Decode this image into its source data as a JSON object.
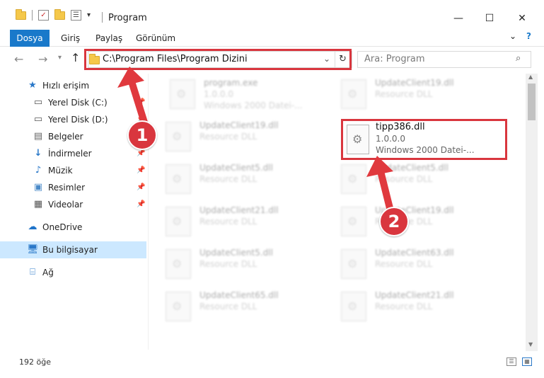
{
  "window": {
    "title": "Program",
    "minimize": "—",
    "maximize": "☐",
    "close": "✕"
  },
  "ribbon": {
    "tabs": [
      "Dosya",
      "Giriş",
      "Paylaş",
      "Görünüm"
    ],
    "expand": "⌄",
    "help": "?"
  },
  "address": {
    "path": "C:\\Program Files\\Program Dizini",
    "search_placeholder": "Ara: Program"
  },
  "sidebar": {
    "items": [
      {
        "label": "Hızlı erişim",
        "icon": "star-icon"
      },
      {
        "label": "Yerel Disk (C:)",
        "icon": "drive-icon"
      },
      {
        "label": "Yerel Disk (D:)",
        "icon": "drive-icon"
      },
      {
        "label": "Belgeler",
        "icon": "documents-icon"
      },
      {
        "label": "İndirmeler",
        "icon": "download-icon"
      },
      {
        "label": "Müzik",
        "icon": "music-icon"
      },
      {
        "label": "Resimler",
        "icon": "pictures-icon"
      },
      {
        "label": "Videolar",
        "icon": "video-icon"
      },
      {
        "label": "OneDrive",
        "icon": "cloud-icon"
      },
      {
        "label": "Bu bilgisayar",
        "icon": "computer-icon"
      },
      {
        "label": "Ağ",
        "icon": "network-icon"
      }
    ]
  },
  "files": [
    {
      "name": "program.exe",
      "line2": "1.0.0.0",
      "line3": "Windows 2000 Datei-..."
    },
    {
      "name": "UpdateClient19.dll",
      "line2": "Resource DLL"
    },
    {
      "name": "UpdateClient19.dll",
      "line2": "Resource DLL"
    },
    {
      "name": "UpdateClient5.dll",
      "line2": "Resource DLL"
    },
    {
      "name": "UpdateClient5.dll",
      "line2": "Resource DLL"
    },
    {
      "name": "UpdateClient21.dll",
      "line2": "Resource DLL"
    },
    {
      "name": "UpdateClient19.dll",
      "line2": "Resource DLL"
    },
    {
      "name": "UpdateClient5.dll",
      "line2": "Resource DLL"
    },
    {
      "name": "UpdateClient63.dll",
      "line2": "Resource DLL"
    },
    {
      "name": "UpdateClient65.dll",
      "line2": "Resource DLL"
    },
    {
      "name": "UpdateClient21.dll",
      "line2": "Resource DLL"
    }
  ],
  "target_file": {
    "name": "tipp386.dll",
    "version": "1.0.0.0",
    "type": "Windows 2000 Datei-..."
  },
  "status": {
    "count": "192 öğe"
  },
  "annotations": {
    "badge1": "1",
    "badge2": "2",
    "color": "#d9363e"
  }
}
